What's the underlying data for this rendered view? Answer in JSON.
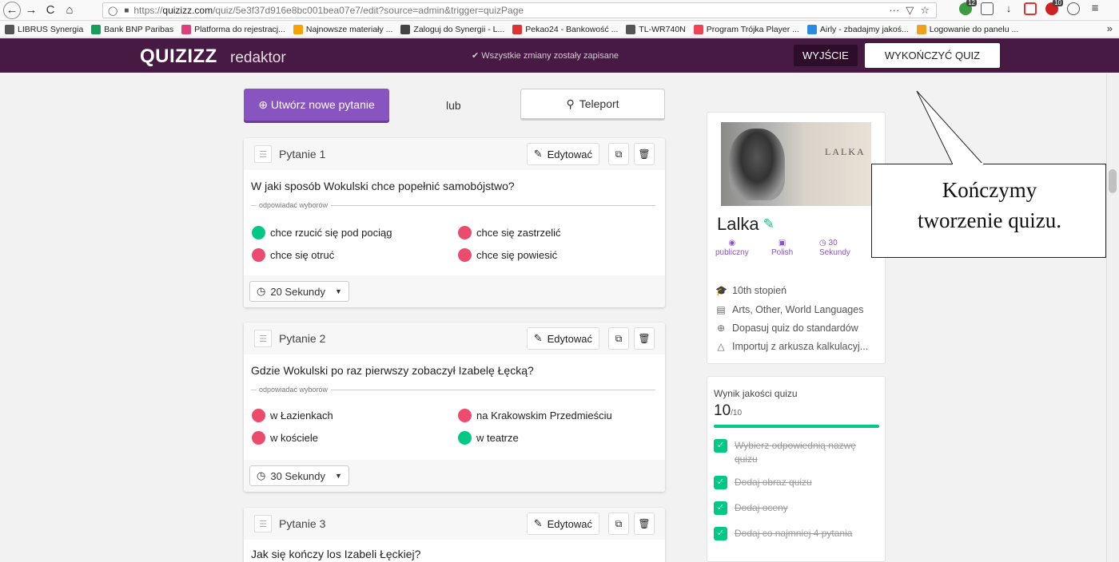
{
  "browser": {
    "url_prefix": "https://",
    "url_domain": "quizizz.com",
    "url_path": "/quiz/5e3f37d916e8bc001bea07e7/edit?source=admin&trigger=quizPage",
    "nav_back": "←",
    "nav_forward": "→",
    "nav_reload": "C",
    "nav_home": "⌂",
    "actions_more": "···",
    "ext_badges": [
      "12",
      "10"
    ],
    "bookmarks": [
      {
        "label": "LIBRUS Synergia",
        "color": "#555"
      },
      {
        "label": "Bank BNP Paribas",
        "color": "#1a9c5c"
      },
      {
        "label": "Platforma do rejestracj...",
        "color": "#e0407a"
      },
      {
        "label": "Najnowsze materiały ...",
        "color": "#f4a300"
      },
      {
        "label": "Zaloguj do Synergii - L...",
        "color": "#444"
      },
      {
        "label": "Pekao24 - Bankowość ...",
        "color": "#d33"
      },
      {
        "label": "TL-WR740N",
        "color": "#555"
      },
      {
        "label": "Program Trójka Player ...",
        "color": "#e45"
      },
      {
        "label": "Airly - zbadajmy jakoś...",
        "color": "#2a8ae0"
      },
      {
        "label": "Logowanie do panelu ...",
        "color": "#f0a020"
      }
    ],
    "bookmarks_more": "»"
  },
  "header": {
    "logo": "QUIZIZZ",
    "logo_sub": "redaktor",
    "saved_status": "✔ Wszystkie zmiany zostały zapisane",
    "exit_label": "WYJŚCIE",
    "finish_label": "WYKOŃCZYĆ QUIZ",
    "color": "#461a42"
  },
  "toolbar": {
    "create_label": "⊕ Utwórz nowe pytanie",
    "or_label": "lub",
    "teleport_label": "Teleport"
  },
  "questions": [
    {
      "label": "Pytanie 1",
      "edit_label": "Edytować",
      "text": "W jaki sposób Wokulski chce popełnić samobójstwo?",
      "answers_label": "odpowiadać wyborów",
      "answers": [
        {
          "text": "chce rzucić się pod pociąg",
          "correct": true
        },
        {
          "text": "chce się zastrzelić",
          "correct": false
        },
        {
          "text": "chce się otruć",
          "correct": false
        },
        {
          "text": "chce się powiesić",
          "correct": false
        }
      ],
      "time": "20 Sekundy"
    },
    {
      "label": "Pytanie 2",
      "edit_label": "Edytować",
      "text": "Gdzie Wokulski po raz pierwszy zobaczył Izabelę Łęcką?",
      "answers_label": "odpowiadać wyborów",
      "answers": [
        {
          "text": "w Łazienkach",
          "correct": false
        },
        {
          "text": "na Krakowskim Przedmieściu",
          "correct": false
        },
        {
          "text": "w kościele",
          "correct": false
        },
        {
          "text": "w teatrze",
          "correct": true
        }
      ],
      "time": "30 Sekundy"
    },
    {
      "label": "Pytanie 3",
      "edit_label": "Edytować",
      "text": "Jak się kończy los Izabeli Łęckiej?"
    }
  ],
  "quiz_info": {
    "cover_text": "LALKA",
    "title": "Lalka",
    "visibility": "publiczny",
    "language": "Polish",
    "time_value": "30",
    "time_unit": "Sekundy",
    "grade": "10th stopień",
    "subjects": "Arts, Other, World Languages",
    "standards": "Dopasuj quiz do standardów",
    "import": "Importuj z arkusza kalkulacyj..."
  },
  "quality": {
    "label": "Wynik jakości quizu",
    "score": "10",
    "max": "/10",
    "fraction": 1.0,
    "checks": [
      "Wybierz odpowiednią nazwę quizu",
      "Dodaj obraz quizu",
      "Dodaj oceny",
      "Dodaj co najmniej 4 pytania"
    ]
  },
  "callout": {
    "line1": "Kończymy",
    "line2": "tworzenie quizu."
  }
}
